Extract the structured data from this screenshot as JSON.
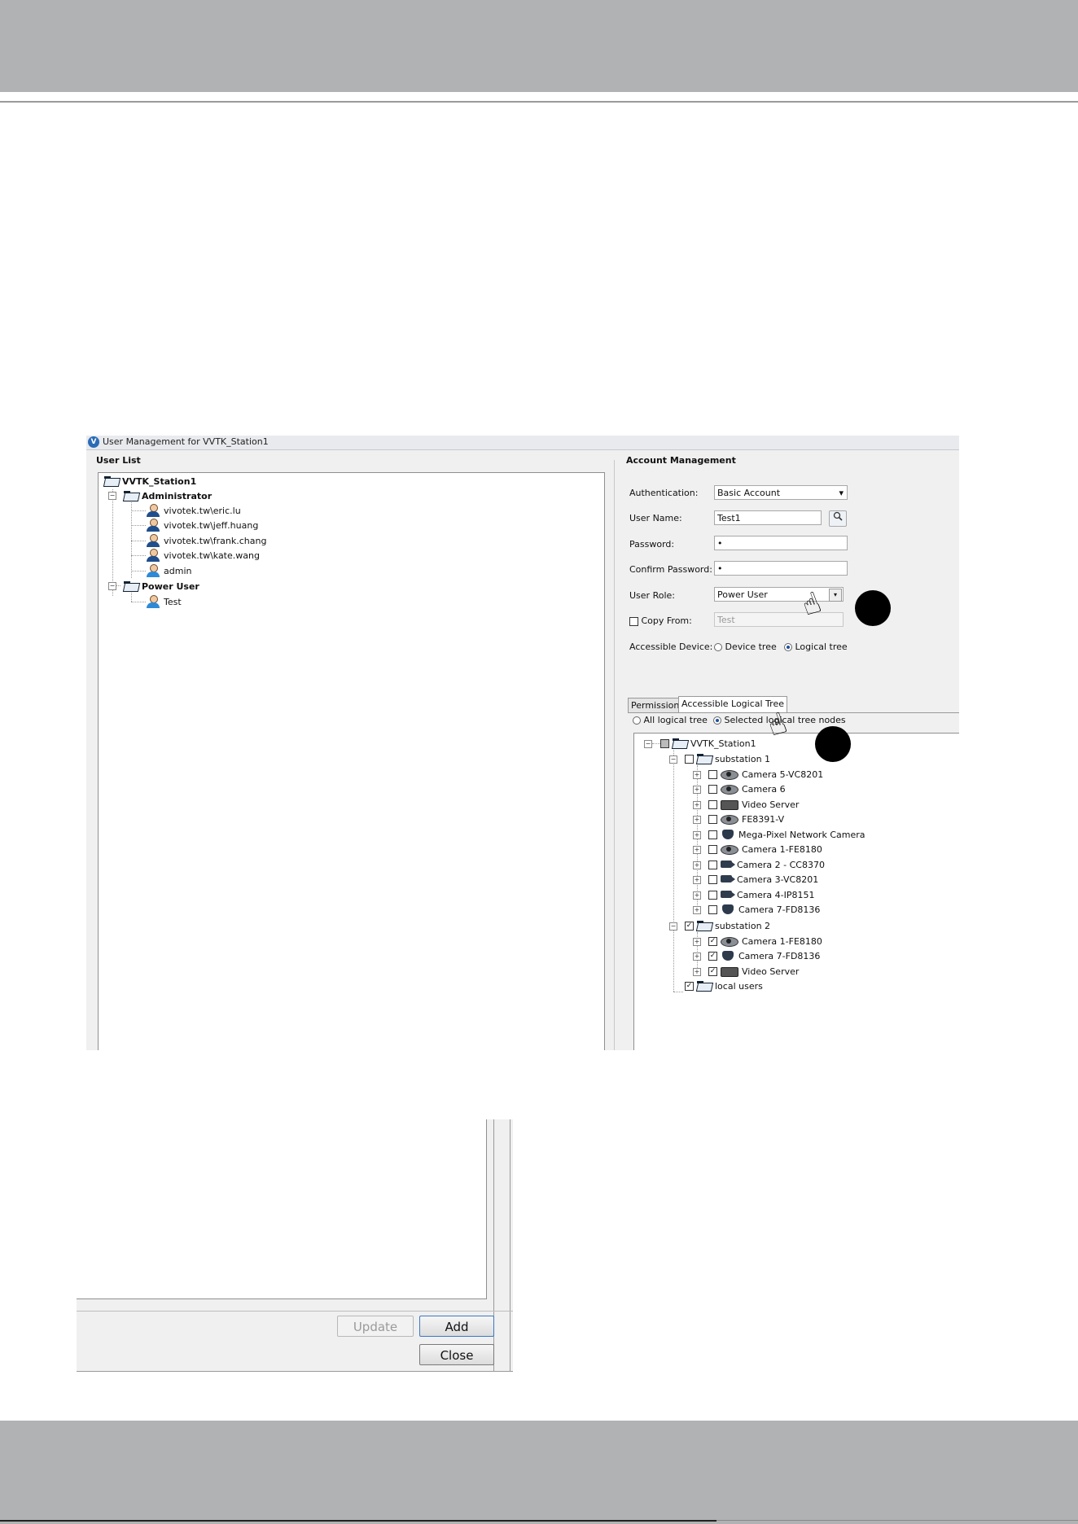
{
  "window": {
    "title": "User Management for VVTK_Station1",
    "app_icon": "V"
  },
  "user_list": {
    "label": "User List",
    "root": "VVTK_Station1",
    "groups": [
      {
        "name": "Administrator",
        "users": [
          "vivotek.tw\\eric.lu",
          "vivotek.tw\\jeff.huang",
          "vivotek.tw\\frank.chang",
          "vivotek.tw\\kate.wang",
          "admin"
        ]
      },
      {
        "name": "Power User",
        "users": [
          "Test"
        ]
      }
    ]
  },
  "account": {
    "label": "Account Management",
    "authentication_label": "Authentication:",
    "authentication_value": "Basic Account",
    "username_label": "User Name:",
    "username_value": "Test1",
    "password_label": "Password:",
    "password_value": "•",
    "confirm_label": "Confirm Password:",
    "confirm_value": "•",
    "role_label": "User Role:",
    "role_value": "Power User",
    "copy_from_label": "Copy From:",
    "copy_from_value": "Test",
    "device_label": "Accessible Device:",
    "device_option1": "Device tree",
    "device_option2": "Logical tree"
  },
  "tabs": {
    "permission": "Permission",
    "logical": "Accessible Logical Tree"
  },
  "logical_tree": {
    "option_all": "All logical tree",
    "option_selected": "Selected logical tree nodes",
    "root": "VVTK_Station1",
    "substation1": {
      "name": "substation 1",
      "devices": [
        "Camera 5-VC8201",
        "Camera 6",
        "Video Server",
        "FE8391-V",
        "Mega-Pixel Network Camera",
        "Camera 1-FE8180",
        "Camera 2 - CC8370",
        "Camera 3-VC8201",
        "Camera 4-IP8151",
        "Camera 7-FD8136"
      ]
    },
    "substation2": {
      "name": "substation 2",
      "devices": [
        "Camera 1-FE8180",
        "Camera 7-FD8136",
        "Video Server"
      ]
    },
    "local_users": "local users"
  },
  "buttons": {
    "update": "Update",
    "add": "Add",
    "close": "Close"
  },
  "icons": {
    "search": "magnifier-icon",
    "check": "✓",
    "collapse": "−",
    "expand": "+",
    "dropdown": "▾",
    "hand": "☝"
  }
}
